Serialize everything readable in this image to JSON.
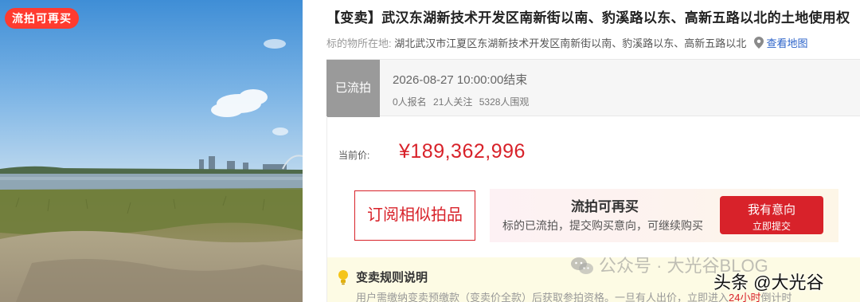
{
  "photo": {
    "badge": "流拍可再买"
  },
  "listing": {
    "title": "【变卖】武汉东湖新技术开发区南新街以南、豹溪路以东、高新五路以北的土地使用权",
    "location_label": "标的物所在地:",
    "location": "湖北武汉市江夏区东湖新技术开发区南新街以南、豹溪路以东、高新五路以北",
    "map_link": "查看地图",
    "pin_icon": "map-pin-icon"
  },
  "status": {
    "tag": "已流拍",
    "end_time": "2026-08-27 10:00:00结束",
    "registrations": "0人报名",
    "followers": "21人关注",
    "viewers": "5328人围观"
  },
  "price": {
    "label": "当前价:",
    "value": "¥189,362,996"
  },
  "actions": {
    "subscribe_label": "订阅相似拍品",
    "resell_title": "流拍可再买",
    "resell_desc": "标的已流拍，提交购买意向，可继续购买",
    "intent_label": "我有意向",
    "intent_sub": "立即提交"
  },
  "rules": {
    "title": "变卖规则说明",
    "text_before": "用户需缴纳变卖预缴款（变卖价全款）后获取参拍资格。一旦有人出价，立即进入",
    "text_highlight": "24小时",
    "text_after": "倒计时",
    "icon": "lightbulb-icon"
  },
  "watermarks": {
    "wechat": "公众号 · 大光谷BLOG",
    "toutiao": "头条 @大光谷"
  },
  "colors": {
    "accent": "#d8222a",
    "badge": "#ff3b2f",
    "status_gray": "#9a9a9a",
    "link": "#2a62c9"
  }
}
